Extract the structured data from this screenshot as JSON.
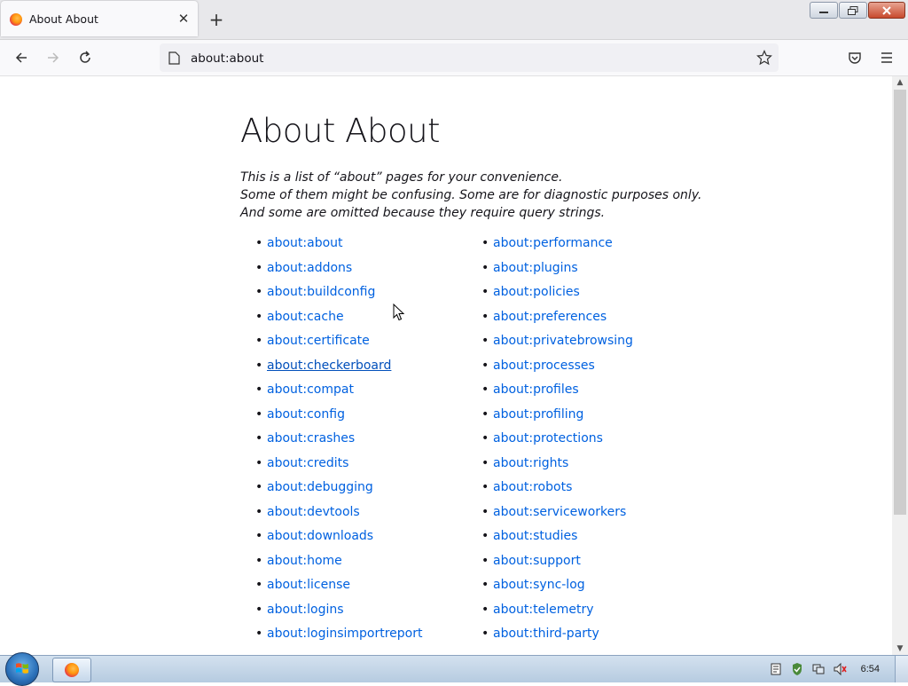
{
  "browser": {
    "tab": {
      "title": "About About",
      "close_icon": "close-icon"
    },
    "new_tab_icon": "plus-icon",
    "url": "about:about"
  },
  "page": {
    "title": "About About",
    "intro": [
      "This is a list of “about” pages for your convenience.",
      "Some of them might be confusing. Some are for diagnostic purposes only.",
      "And some are omitted because they require query strings."
    ],
    "left_links": [
      "about:about",
      "about:addons",
      "about:buildconfig",
      "about:cache",
      "about:certificate",
      "about:checkerboard",
      "about:compat",
      "about:config",
      "about:crashes",
      "about:credits",
      "about:debugging",
      "about:devtools",
      "about:downloads",
      "about:home",
      "about:license",
      "about:logins",
      "about:loginsimportreport"
    ],
    "right_links": [
      "about:performance",
      "about:plugins",
      "about:policies",
      "about:preferences",
      "about:privatebrowsing",
      "about:processes",
      "about:profiles",
      "about:profiling",
      "about:protections",
      "about:rights",
      "about:robots",
      "about:serviceworkers",
      "about:studies",
      "about:support",
      "about:sync-log",
      "about:telemetry",
      "about:third-party"
    ],
    "hovered_link": "about:checkerboard",
    "link_color": "#0061e0"
  },
  "taskbar": {
    "clock": "6:54"
  }
}
